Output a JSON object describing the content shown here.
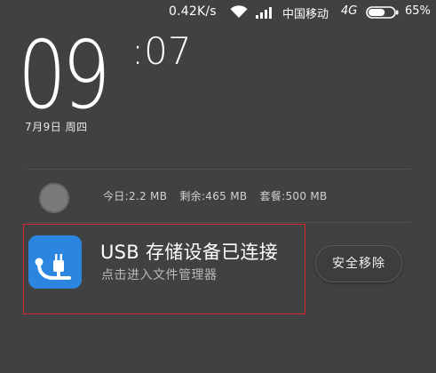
{
  "status_bar": {
    "net_speed": "0.42K/s",
    "carrier": "中国移动",
    "network_type": "4G",
    "battery_percent": "65%",
    "battery_level": 0.65,
    "wifi_icon": "wifi-icon",
    "signal_icon": "signal-bars-icon"
  },
  "lockscreen": {
    "clock_hours": "09",
    "clock_minutes": ":07",
    "date": "7月9日 周四"
  },
  "data_usage": {
    "today": "今日:2.2 MB",
    "remaining": "剩余:465 MB",
    "package": "套餐:500 MB"
  },
  "notification": {
    "title": "USB 存储设备已连接",
    "subtitle": "点击进入文件管理器",
    "action_label": "安全移除",
    "icon": "usb-icon",
    "icon_color": "#2b86e0"
  },
  "colors": {
    "background": "#414141",
    "highlight_border": "#d8262e"
  }
}
